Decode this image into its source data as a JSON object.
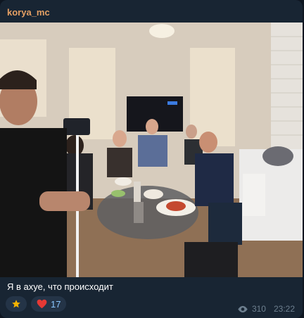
{
  "message": {
    "author": "korya_mc",
    "caption": "Я в ахуе, что происходит",
    "views": "310",
    "time": "23:22"
  },
  "reactions": [
    {
      "icon": "star-icon",
      "count": "",
      "color": "#f5b300"
    },
    {
      "icon": "heart-icon",
      "count": "17",
      "color": "#e53935"
    }
  ],
  "colors": {
    "author": "#e5a064",
    "bubble": "#182533",
    "reaction_bg": "#243447",
    "reaction_text": "#8ac7ff"
  }
}
